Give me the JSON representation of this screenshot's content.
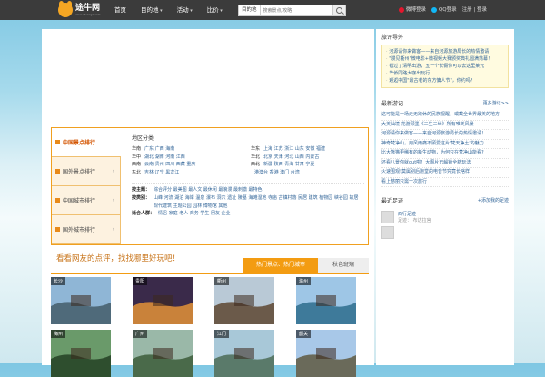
{
  "header": {
    "logo_text": "途牛网",
    "logo_sub": "www.ctuanga.com",
    "nav": [
      {
        "label": "首页",
        "caret": false
      },
      {
        "label": "目的地",
        "caret": true
      },
      {
        "label": "活动",
        "caret": true
      },
      {
        "label": "比价",
        "caret": true
      }
    ],
    "search_scope": "目的地",
    "search_placeholder": "搜索景点/攻略",
    "login": [
      {
        "label": "微博登录",
        "color": "#e6162d"
      },
      {
        "label": "QQ登录",
        "color": "#12b7f5"
      }
    ],
    "register": "注册 | 登录"
  },
  "scenic": {
    "tabs": [
      {
        "label": "中国景点排行",
        "active": true
      },
      {
        "label": "国外景点排行",
        "active": false
      },
      {
        "label": "中国城市排行",
        "active": false
      },
      {
        "label": "国外城市排行",
        "active": false
      }
    ],
    "section_title": "地区分类",
    "regions": [
      {
        "k": "华南",
        "v": "广东 广西 海南"
      },
      {
        "k": "华东",
        "v": "上海 江苏 浙江 山东 安徽 福建"
      },
      {
        "k": "华中",
        "v": "湖北 湖南 河南 江西"
      },
      {
        "k": "华北",
        "v": "北京 天津 河北 山西 内蒙古"
      },
      {
        "k": "西南",
        "v": "云南 贵州 四川 西藏 重庆"
      },
      {
        "k": "西北",
        "v": "新疆 陕西 青海 甘肃 宁夏"
      },
      {
        "k": "东北",
        "v": "吉林 辽宁 黑龙江"
      },
      {
        "k": "",
        "v": "港澳台  香港 澳门 台湾"
      }
    ],
    "topics": [
      {
        "k": "按主题：",
        "v": "综合评分 最美图 最人文 最休闲 最浪漫 最刺激 最特色"
      },
      {
        "k": "按类别：",
        "v": "山峰 河流 湖泊 海岸 温泉 瀑布 洞穴 遗址 陵墓 海滩湿地 寺庙 古镇村落 民居 建筑 植物园 峡谷园 故居 现代建筑 主题公园 园林 博物馆 其他"
      },
      {
        "k": "适合人群：",
        "v": "情侣 家庭 老人 商务 学生 朋友 企业"
      }
    ]
  },
  "slogan": "看看网友的点评，找找哪里好玩吧！",
  "hot_tabs": [
    "热门景点、热门城市",
    "秋色斑斓"
  ],
  "tiles": [
    {
      "label": "长沙",
      "sky": "#8fb6d6",
      "ground": "#4f6a7a"
    },
    {
      "label": "贵阳",
      "sky": "#3a2a4a",
      "ground": "#c9823a"
    },
    {
      "label": "衢州",
      "sky": "#b9c9d6",
      "ground": "#6b5a4a"
    },
    {
      "label": "滁州",
      "sky": "#9ec6e6",
      "ground": "#3e7a9a"
    },
    {
      "label": "梅州",
      "sky": "#6a9a6a",
      "ground": "#2e4e2e"
    },
    {
      "label": "广州",
      "sky": "#9ab8a8",
      "ground": "#4a6a4a"
    },
    {
      "label": "江门",
      "sky": "#a8c8d8",
      "ground": "#5a7a6a"
    },
    {
      "label": "韶关",
      "sky": "#a8c8e8",
      "ground": "#6a6a5a"
    }
  ],
  "sidebar": {
    "notice_title": "旅评导外",
    "notices": [
      "河源请你来做客——来自河源旅游局长的热情邀请！",
      "\"漫见衢州\"微电影+微视频大赛颁奖典礼圆满落幕！",
      "错过了清明出游，五一个长假你可以去这里莱元",
      "华侨同路大咖出玩行",
      "邂逅中国\"最古老的东方慵人节\"，你约吗？"
    ],
    "travel_title": "最新游记",
    "travel_more": "更多游记>>",
    "travels": [
      "这可能是一场走无欲休的民族视醒，或截全世界最美的地方",
      "大美仙境 花游顾墨《三生三世》所有唯美风景",
      "河源请你来做客——来自河源旅游局长的热情邀请！",
      "神奇梵净山，用风雨痛不顾爱这片'梵天净土'的魅力",
      "比大熊猫更稀有的新生动物，为何只在梵净山能看?",
      "还看八景你就out啦！大图片已解锁全新玩法",
      "火速围观!莫属别后跑堂的电音节究竟长啥样",
      "看上慈丽只需一次旅行"
    ],
    "foot_title": "最近足迹",
    "foot_more": "+添加我的足迹",
    "foot": [
      {
        "name": "西行足迹",
        "place": "足迹：   布达拉宫"
      },
      {
        "name": "",
        "place": ""
      }
    ]
  }
}
